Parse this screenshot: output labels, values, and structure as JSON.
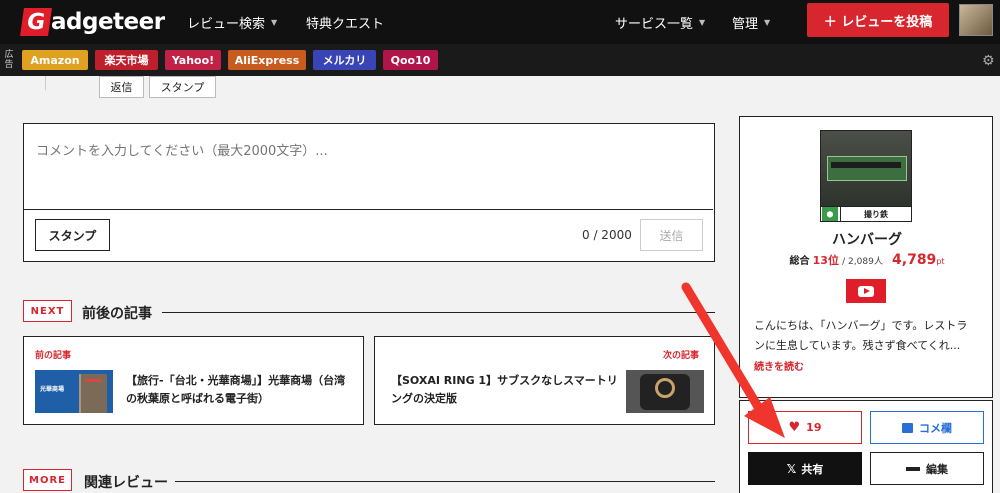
{
  "header": {
    "logo_g": "G",
    "logo_rest": "adgeteer",
    "nav_review_search": "レビュー検索",
    "nav_quest": "特典クエスト",
    "nav_services": "サービス一覧",
    "nav_admin": "管理",
    "post_review": "＋ レビューを投稿"
  },
  "adbar": {
    "label": "広告",
    "shops": [
      {
        "label": "Amazon",
        "color": "#e0a020"
      },
      {
        "label": "楽天市場",
        "color": "#bf1f2a"
      },
      {
        "label": "Yahoo!",
        "color": "#c02144"
      },
      {
        "label": "AliExpress",
        "color": "#c95b1e"
      },
      {
        "label": "メルカリ",
        "color": "#3a45b5"
      },
      {
        "label": "Qoo10",
        "color": "#b0154a"
      }
    ]
  },
  "reply_chips": {
    "reply": "返信",
    "stamp": "スタンプ"
  },
  "comment": {
    "placeholder": "コメントを入力してください（最大2000文字）...",
    "stamp_button": "スタンプ",
    "counter": "0 / 2000",
    "send_button": "送信"
  },
  "sections": {
    "next_tag": "NEXT",
    "next_title": "前後の記事",
    "more_tag": "MORE",
    "more_title": "関連レビュー"
  },
  "articles": {
    "prev_label": "前の記事",
    "prev_title_line1": "【旅行-「台北・光華商場」】光華商場（台湾",
    "prev_title_line2": "の秋葉原と呼ばれる電子街）",
    "prev_thumb_text": "光華商場",
    "next_label": "次の記事",
    "next_title_line1": "【SOXAI RING 1】サブスクなしスマートリ",
    "next_title_line2": "ングの決定版"
  },
  "profile": {
    "badge": "撮り鉄",
    "name": "ハンバーグ",
    "rank_prefix": "総合",
    "rank": "13位",
    "rank_total": "/ 2,089人",
    "points": "4,789",
    "points_unit": "pt",
    "bio_line1": "こんにちは、「ハンバーグ」です。レストラ",
    "bio_line2": "ンに生息しています。残さず食べてくれ...",
    "read_more": "続きを読む"
  },
  "actions": {
    "like_count": "19",
    "comments": "コメ欄",
    "share": "共有",
    "edit": "編集"
  },
  "colors": {
    "brand_red": "#d7262d",
    "accent_blue": "#2a6fd6"
  },
  "icons": {
    "gear": "gear-icon",
    "heart": "heart-icon",
    "x_logo": "x-logo-icon",
    "youtube": "youtube-icon",
    "android": "android-icon"
  }
}
